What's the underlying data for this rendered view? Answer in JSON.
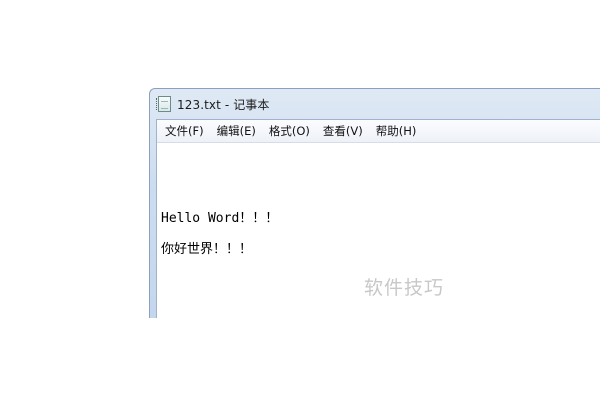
{
  "window": {
    "title": "123.txt - 记事本"
  },
  "menubar": {
    "items": [
      {
        "label": "文件(F)"
      },
      {
        "label": "编辑(E)"
      },
      {
        "label": "格式(O)"
      },
      {
        "label": "查看(V)"
      },
      {
        "label": "帮助(H)"
      }
    ]
  },
  "editor": {
    "lines": [
      "Hello Word！！！",
      "你好世界！！！"
    ]
  },
  "watermark": {
    "text": "软件技巧"
  },
  "icons": {
    "app_icon": "notepad-document-icon"
  }
}
